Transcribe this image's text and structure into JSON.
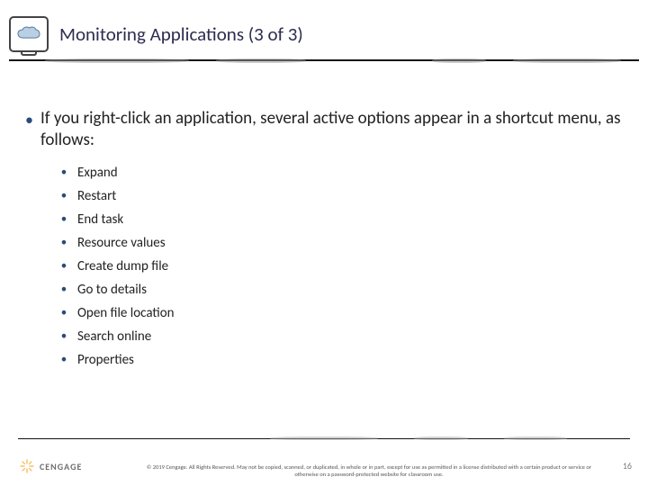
{
  "header": {
    "title": "Monitoring Applications (3 of 3)",
    "icon": "cloud-monitor-icon"
  },
  "content": {
    "main_point": "If you right-click an application, several active options appear in a shortcut menu, as follows:",
    "options": [
      "Expand",
      "Restart",
      "End task",
      "Resource values",
      "Create dump file",
      "Go to details",
      "Open file location",
      "Search online",
      "Properties"
    ]
  },
  "footer": {
    "brand": "CENGAGE",
    "copyright": "© 2019 Cengage. All Rights Reserved. May not be copied, scanned, or duplicated, in whole or in part, except for use as permitted in a license distributed with a certain product or service or otherwise on a password-protected website for classroom use.",
    "page": "16"
  }
}
